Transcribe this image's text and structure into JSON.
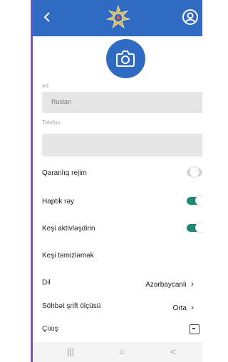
{
  "header": {
    "back_icon": "chevron-left-icon",
    "emblem": "azerbaijan-emblem-icon",
    "profile_icon": "user-circle-icon",
    "color": "#2f6bc3"
  },
  "avatar": {
    "icon": "camera-icon"
  },
  "form": {
    "name_label": "ad",
    "name_value": "Ruslan",
    "phone_label": "Telefon",
    "phone_value": ""
  },
  "settings": {
    "dark_mode": {
      "label": "Qaranlıq rejim",
      "state": "off"
    },
    "haptic": {
      "label": "Haptik rəy",
      "state": "on"
    },
    "cache_enable": {
      "label": "Keşi aktivləşdirin",
      "state": "on"
    },
    "cache_clear": {
      "label": "Keşi təmizləmək"
    },
    "language": {
      "label": "Dil",
      "value": "Azərbaycanlı"
    },
    "font_size": {
      "label": "Söhbət şrift ölçüsü",
      "value": "Orta"
    },
    "logout": {
      "label": "Çıxış",
      "icon": "logout-icon"
    }
  },
  "navbar": {
    "recents": "|||",
    "home": "○",
    "back": "<"
  },
  "colors": {
    "accent": "#7c4dcc",
    "toggle_on": "#1d8a73"
  }
}
